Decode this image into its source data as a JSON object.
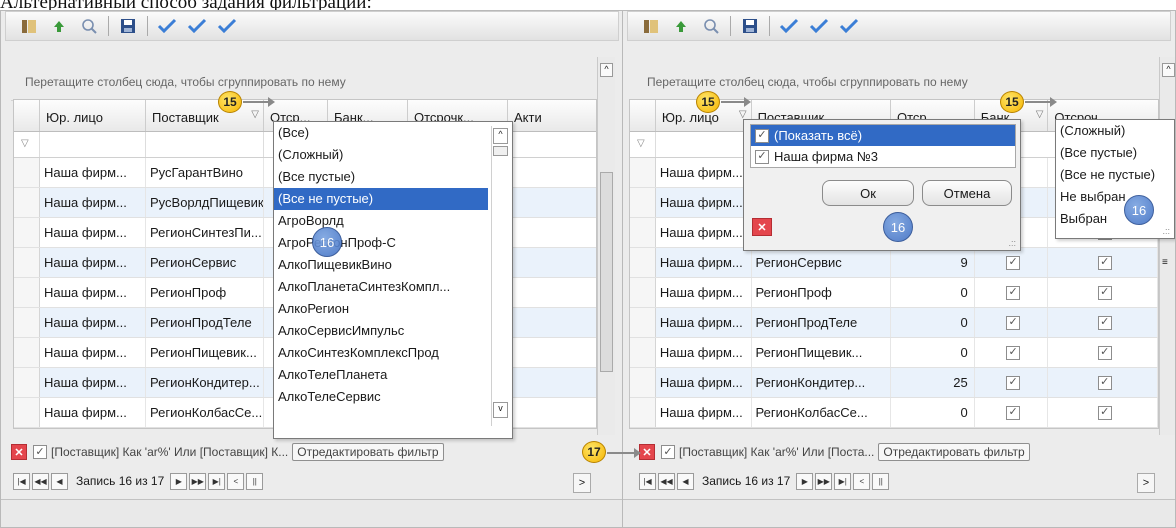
{
  "page_title": "Альтернативный способ задания фильтрации:",
  "group_hint": "Перетащите столбец сюда, чтобы сгруппировать по нему",
  "left": {
    "columns": [
      "Юр. лицо",
      "Поставщик",
      "Отср...",
      "Банк...",
      "Отсрочк...",
      "Акти"
    ],
    "rows": [
      [
        "Наша фирм...",
        "РусГарантВино"
      ],
      [
        "Наша фирм...",
        "РусВорлдПищевик"
      ],
      [
        "Наша фирм...",
        "РегионСинтезПи..."
      ],
      [
        "Наша фирм...",
        "РегионСервис"
      ],
      [
        "Наша фирм...",
        "РегионПроф"
      ],
      [
        "Наша фирм...",
        "РегионПродТеле"
      ],
      [
        "Наша фирм...",
        "РегионПищевик..."
      ],
      [
        "Наша фирм...",
        "РегионКондитер..."
      ],
      [
        "Наша фирм...",
        "РегионКолбасСе..."
      ]
    ],
    "dropdown": [
      "(Все)",
      "(Сложный)",
      "(Все пустые)",
      "(Все не пустые)",
      "АгроВорлд",
      "АгроРегионПроф-С",
      "АлкоПищевикВино",
      "АлкоПланетаСинтезКомпл...",
      "АлкоРегион",
      "АлкоСервисИмпульс",
      "АлкоСинтезКомплексПрод",
      "АлкоТелеПланета",
      "АлкоТелеСервис"
    ],
    "dropdown_selected": 3,
    "filter_text": "[Поставщик] Как 'ar%' Или [Поставщик] К...",
    "edit_filter": "Отредактировать фильтр",
    "record": "Запись 16 из 17"
  },
  "right": {
    "columns": [
      "Юр. лицо",
      "Поставщик",
      "Отср...",
      "Банк...",
      "Отсроч..."
    ],
    "rows": [
      [
        "Наша фирм...",
        "",
        "",
        "",
        ""
      ],
      [
        "Наша фирм...",
        "",
        "",
        "",
        ""
      ],
      [
        "Наша фирм...",
        "",
        "",
        "",
        ""
      ],
      [
        "Наша фирм...",
        "РегионСервис",
        "9",
        "",
        ""
      ],
      [
        "Наша фирм...",
        "РегионПроф",
        "0",
        "",
        ""
      ],
      [
        "Наша фирм...",
        "РегионПродТеле",
        "0",
        "",
        ""
      ],
      [
        "Наша фирм...",
        "РегионПищевик...",
        "0",
        "",
        ""
      ],
      [
        "Наша фирм...",
        "РегионКондитер...",
        "25",
        "",
        ""
      ],
      [
        "Наша фирм...",
        "РегионКолбасСе...",
        "0",
        "",
        ""
      ]
    ],
    "checklist": [
      "(Показать всё)",
      "Наша фирма №3"
    ],
    "ok": "Ок",
    "cancel": "Отмена",
    "dropdown": [
      "(Сложный)",
      "(Все пустые)",
      "(Все не пустые)",
      "Не выбран",
      "Выбран"
    ],
    "filter_text": "[Поставщик] Как 'ar%' Или [Поста...",
    "edit_filter": "Отредактировать фильтр",
    "record": "Запись 16 из 17"
  },
  "callouts": {
    "b15": "15",
    "b16": "16",
    "b17": "17"
  }
}
